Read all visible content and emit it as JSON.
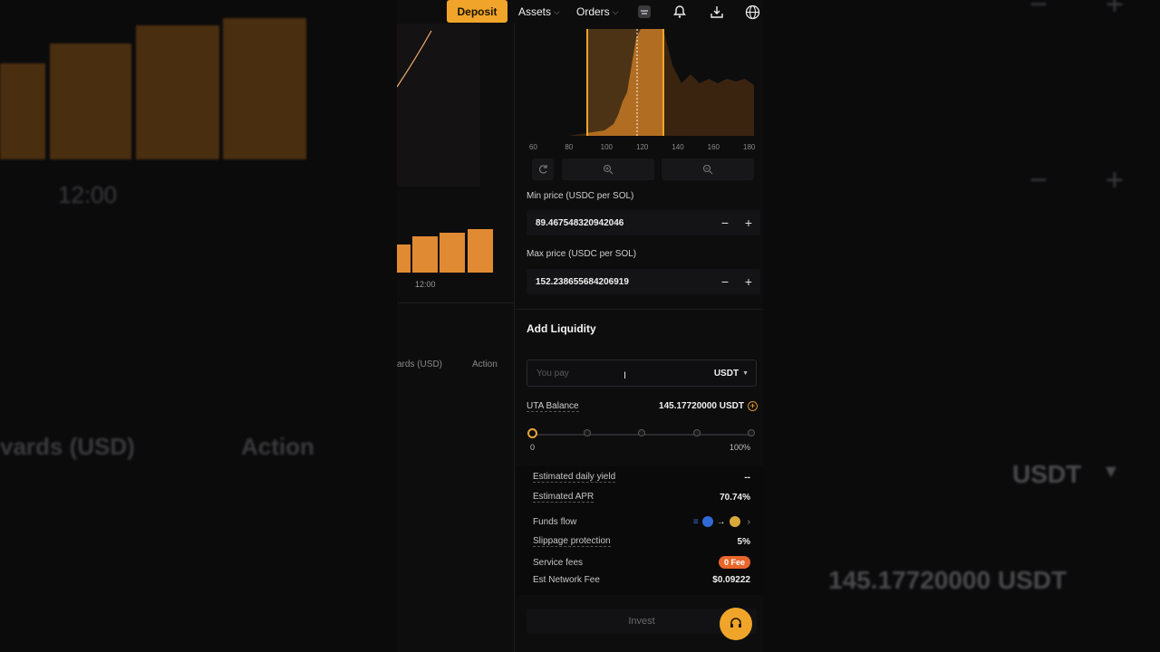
{
  "background": {
    "left_time": "12:00",
    "left_col1": "vards (USD)",
    "left_col2": "Action",
    "right_currency": "USDT",
    "right_balance": "145.17720000 USDT"
  },
  "topbar": {
    "deposit_label": "Deposit",
    "assets_label": "Assets",
    "orders_label": "Orders"
  },
  "left_pane": {
    "x_label": "12:00",
    "col_rewards": "ards (USD)",
    "col_action": "Action"
  },
  "range": {
    "axis_ticks": [
      "60",
      "80",
      "100",
      "120",
      "140",
      "160",
      "180"
    ],
    "min_label": "Min price (USDC per SOL)",
    "min_value": "89.467548320942046",
    "max_label": "Max price (USDC per SOL)",
    "max_value": "152.238655684206919"
  },
  "add_liquidity": {
    "title": "Add Liquidity",
    "pay_placeholder": "You pay",
    "currency": "USDT",
    "balance_label": "UTA Balance",
    "balance_value": "145.17720000 USDT",
    "slider_min": "0",
    "slider_max": "100%",
    "slider_value": 0
  },
  "details": {
    "daily_yield_label": "Estimated daily yield",
    "daily_yield_value": "--",
    "apr_label": "Estimated APR",
    "apr_value": "70.74%",
    "funds_flow_label": "Funds flow",
    "slippage_label": "Slippage protection",
    "slippage_value": "5%",
    "service_fees_label": "Service fees",
    "service_fees_value": "0 Fee",
    "network_fee_label": "Est Network Fee",
    "network_fee_value": "$0.09222"
  },
  "invest_label": "Invest",
  "colors": {
    "accent": "#f0a52a",
    "fee_badge": "#e8662b"
  }
}
